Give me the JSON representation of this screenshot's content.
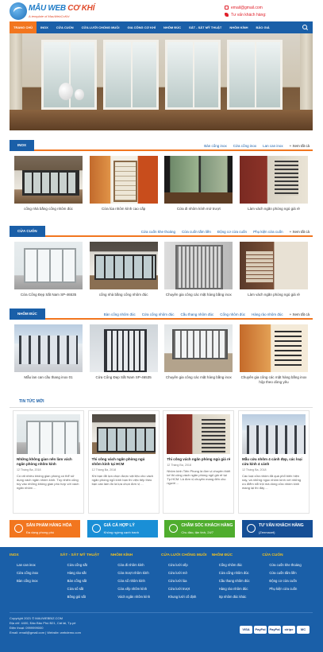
{
  "header": {
    "logo_main": "MẪU WEB",
    "logo_highlight": "CƠ KHÍ",
    "logo_sub": "A template of MauWebCoKhi",
    "email": "email@gmail.com",
    "phone_label": "Tư vấn khách hàng:"
  },
  "nav": {
    "items": [
      "TRANG CHỦ",
      "INOX",
      "CỬA CUỐN",
      "CỬA LƯỚI CHỐNG MUỖI",
      "GIA CÔNG CƠ KHÍ",
      "NHÔM ĐÚC",
      "SẮT - SẮT MỸ THUẬT",
      "NHÔM KÍNH",
      "BẢO GIÁ"
    ]
  },
  "sections": [
    {
      "title": "INOX",
      "links": [
        "Bàn cổng inox",
        "Cửa cổng inox",
        "Lan can inox"
      ],
      "more": "+ Xem tất cả",
      "items": [
        "cổng nhà bằng cổng nhôm đúc",
        "Cửa lùa nhôm kính cao cấp",
        "Cửa đi nhôm kính mở trượt",
        "Làm vách ngăn phòng ngủ giá rẻ"
      ]
    },
    {
      "title": "CỬA CUỐN",
      "links": [
        "Cửa cuốn khe thoáng",
        "Cửa cuốn tấm liền",
        "Động cơ cửa cuốn",
        "Phụ kiện cửa cuốn"
      ],
      "more": "+ Xem tất cả",
      "items": [
        "Cửa Cổng Đẹp Sắt Nam SP-46535",
        "cổng nhà bằng cổng nhôm đúc",
        "Chuyên gia công các mặt hàng bằng inox",
        "Làm vách ngăn phòng ngủ giá rẻ"
      ]
    },
    {
      "title": "NHÔM ĐÚC",
      "links": [
        "Bàn cổng nhôm đúc",
        "Cửa cổng nhôm đúc",
        "Cầu thang nhôm đúc",
        "Cổng nhôm đúc",
        "Hàng rào nhôm đúc"
      ],
      "more": "+ Xem tất cả",
      "items": [
        "Mẫu lan can cầu thang inox 01",
        "Cửa Cổng Đẹp Sắt Nam SP-46535",
        "Chuyên gia công các mặt hàng bằng inox",
        "Chuyên gia công các mặt hàng bằng inox hộp theo dòng yêu"
      ]
    }
  ],
  "news": {
    "title": "TIN TỨC MỚI",
    "items": [
      {
        "name": "Những không gian nên làm vách ngăn phòng nhôm kính",
        "date": "12 Tháng Ba, 2018",
        "desc": "Có rất nhiều không gian phòng có thể sử dụng vách ngăn nhôm kính. Tùy nhiên cũng tùy vào những không gian phù hợp với vách ngăn nhôm ..."
      },
      {
        "name": "Thi công vách ngăn phòng ngủ nhôm kính tại HCM",
        "date": "12 Tháng Ba, 2018",
        "desc": "Khi bạn đã lựa chọn được vật liệu cho vách ngăn phòng ngủ kính bạn thì việc tiếp theo bạn cần làm đó là lựa chọn đơn vị ..."
      },
      {
        "name": "Thi công vách ngăn phòng ngủ giá rẻ",
        "date": "12 Tháng Ba, 2018",
        "desc": "Nhôm kính Tiến Phong là đơn vị chuyên thiết kế thi công vách ngăn phòng ngủ giá rẻ tại Tp.HCM. Là đơn vị chuyên mang đến cho người ..."
      },
      {
        "name": "Mẫu cửa nhôm 4 cánh đẹp, các loại cửa kính 4 cánh",
        "date": "12 Tháng Ba, 2018",
        "desc": "Các loại cửa nhôm đã quá phổ biến hiện nay, và những ngục nhôm kính với những ưu điểm nổi trội mà dòng cửa nhôm kính mang lại thì đây ..."
      }
    ]
  },
  "features": [
    {
      "title": "SẢN PHẨM HÀNG HÓA",
      "sub": "Đa dạng phong phú",
      "color": "#f2761f"
    },
    {
      "title": "GIÁ CẢ HỢP LÝ",
      "sub": "Không ngừng cạnh tranh",
      "color": "#1a8fd6"
    },
    {
      "title": "CHĂM SÓC KHÁCH HÀNG",
      "sub": "Chu đáo, tận tình, 24/7",
      "color": "#4fad2e"
    },
    {
      "title": "TƯ VẤN KHÁCH HÀNG",
      "sub": "(Zenmacet)",
      "color": "#164f96"
    }
  ],
  "footer": {
    "columns": [
      {
        "title": "INOX",
        "items": [
          "Lan can inox",
          "Cửa cổng inox",
          "Bàn cổng inox"
        ]
      },
      {
        "title": "SẮT - SẮT MỸ THUẬT",
        "items": [
          "Cửa cổng sắt",
          "Hàng rào sắt",
          "Bàn cổng sắt",
          "Cửa sổ sắt",
          "Bồng gió sắt"
        ]
      },
      {
        "title": "NHÔM KÍNH",
        "items": [
          "Cửa đi nhôm kính",
          "Cửa trượt nhôm kính",
          "Cửa sổ nhôm kính",
          "Cửa xếp nhôm kính",
          "Vách ngăn nhôm kính"
        ]
      },
      {
        "title": "CỬA LƯỚI CHỐNG MUỖI",
        "items": [
          "Cửa lưới xếp",
          "Cửa lưới mở",
          "Cửa lưới lùa",
          "Cửa lưới trượt",
          "Khung lưới cố định"
        ]
      },
      {
        "title": "NHÔM ĐÚC",
        "items": [
          "Cổng nhôm đúc",
          "Cửa cổng nhôm đúc",
          "Cầu thang nhôm đúc",
          "Hàng rào nhôm đúc",
          "Sp nhôm đúc khác"
        ]
      },
      {
        "title": "CỬA CUỐN",
        "items": [
          "Cửa cuốn khe thoáng",
          "Cửa cuốn tấm liền",
          "Động cơ cửa cuốn",
          "Phụ kiện cửa cuốn"
        ]
      }
    ],
    "copy": [
      "Copyright 2021 © MAUWEBBIZ.COM",
      "Địa chỉ: 4400, Đảo Bảo Phú B21, Cát lái, Tp.pè",
      "Điện thoại: 0999999000",
      "Email: email@gmail.com | Website: webdemo.com"
    ],
    "payments": [
      "VISA",
      "PayPal",
      "PayPal",
      "stripe",
      "MC",
      "AE"
    ]
  }
}
